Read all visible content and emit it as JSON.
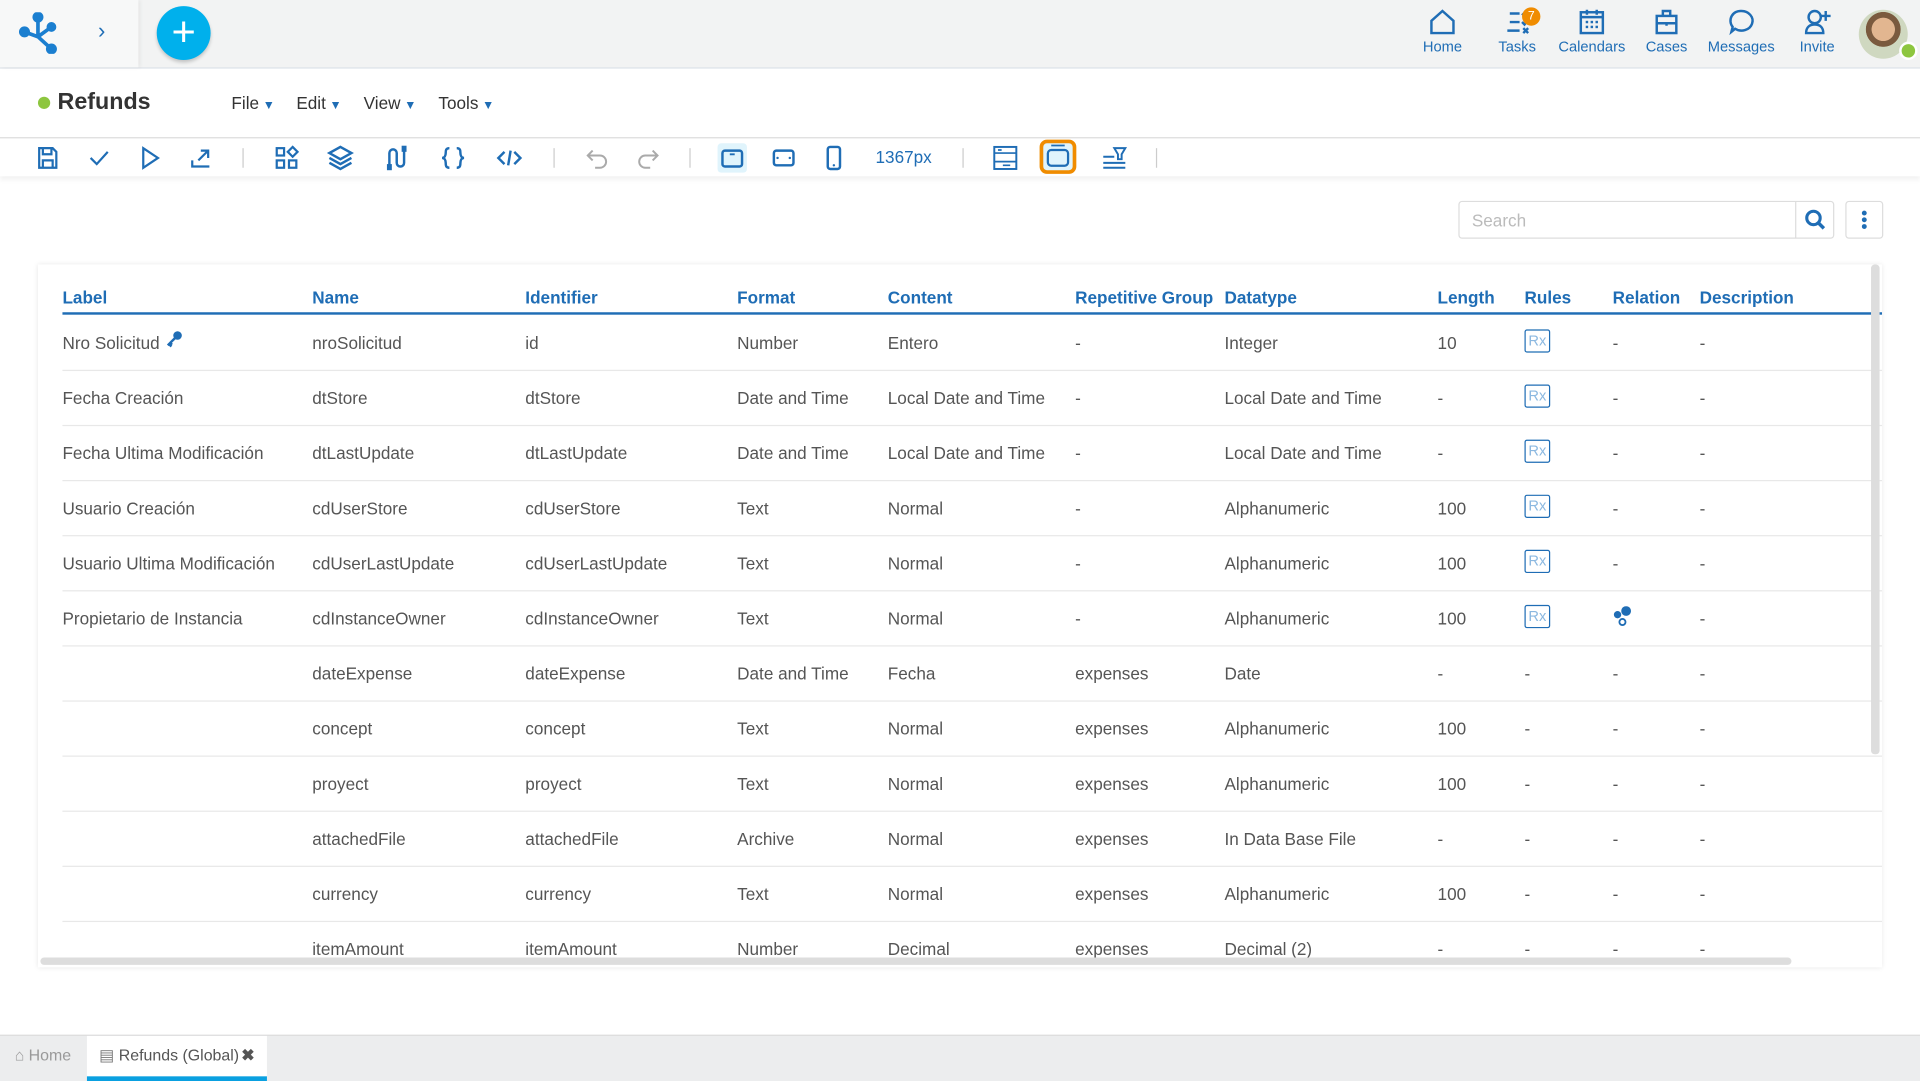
{
  "colors": {
    "accent": "#1f6db5",
    "add": "#00b0ec",
    "status": "#8dc63f",
    "badge": "#f08c00",
    "highlight": "#f08c00"
  },
  "topnav": {
    "items": [
      {
        "label": "Home",
        "icon": "home-icon"
      },
      {
        "label": "Tasks",
        "icon": "tasks-icon",
        "badge": "7"
      },
      {
        "label": "Calendars",
        "icon": "calendar-icon"
      },
      {
        "label": "Cases",
        "icon": "briefcase-icon"
      },
      {
        "label": "Messages",
        "icon": "message-icon"
      },
      {
        "label": "Invite",
        "icon": "invite-user-icon"
      }
    ]
  },
  "header": {
    "title": "Refunds",
    "menus": [
      "File",
      "Edit",
      "View",
      "Tools"
    ]
  },
  "toolbar": {
    "width_label": "1367px"
  },
  "search": {
    "placeholder": "Search",
    "value": ""
  },
  "table": {
    "columns": [
      "Label",
      "Name",
      "Identifier",
      "Format",
      "Content",
      "Repetitive Group",
      "Datatype",
      "Length",
      "Rules",
      "Relation",
      "Description"
    ],
    "rows": [
      {
        "label": "Nro Solicitud",
        "key": true,
        "name": "nroSolicitud",
        "identifier": "id",
        "format": "Number",
        "content": "Entero",
        "group": "-",
        "datatype": "Integer",
        "length": "10",
        "rules": "Rx",
        "relation": "-",
        "description": "-"
      },
      {
        "label": "Fecha Creación",
        "name": "dtStore",
        "identifier": "dtStore",
        "format": "Date and Time",
        "content": "Local Date and Time",
        "group": "-",
        "datatype": "Local Date and Time",
        "length": "-",
        "rules": "Rx",
        "relation": "-",
        "description": "-"
      },
      {
        "label": "Fecha Ultima Modificación",
        "name": "dtLastUpdate",
        "identifier": "dtLastUpdate",
        "format": "Date and Time",
        "content": "Local Date and Time",
        "group": "-",
        "datatype": "Local Date and Time",
        "length": "-",
        "rules": "Rx",
        "relation": "-",
        "description": "-"
      },
      {
        "label": "Usuario Creación",
        "name": "cdUserStore",
        "identifier": "cdUserStore",
        "format": "Text",
        "content": "Normal",
        "group": "-",
        "datatype": "Alphanumeric",
        "length": "100",
        "rules": "Rx",
        "relation": "-",
        "description": "-"
      },
      {
        "label": "Usuario Ultima Modificación",
        "name": "cdUserLastUpdate",
        "identifier": "cdUserLastUpdate",
        "format": "Text",
        "content": "Normal",
        "group": "-",
        "datatype": "Alphanumeric",
        "length": "100",
        "rules": "Rx",
        "relation": "-",
        "description": "-"
      },
      {
        "label": "Propietario de Instancia",
        "name": "cdInstanceOwner",
        "identifier": "cdInstanceOwner",
        "format": "Text",
        "content": "Normal",
        "group": "-",
        "datatype": "Alphanumeric",
        "length": "100",
        "rules": "Rx",
        "relation": "relation-icon",
        "description": "-"
      },
      {
        "label": "",
        "name": "dateExpense",
        "identifier": "dateExpense",
        "format": "Date and Time",
        "content": "Fecha",
        "group": "expenses",
        "datatype": "Date",
        "length": "-",
        "rules": "-",
        "relation": "-",
        "description": "-"
      },
      {
        "label": "",
        "name": "concept",
        "identifier": "concept",
        "format": "Text",
        "content": "Normal",
        "group": "expenses",
        "datatype": "Alphanumeric",
        "length": "100",
        "rules": "-",
        "relation": "-",
        "description": "-"
      },
      {
        "label": "",
        "name": "proyect",
        "identifier": "proyect",
        "format": "Text",
        "content": "Normal",
        "group": "expenses",
        "datatype": "Alphanumeric",
        "length": "100",
        "rules": "-",
        "relation": "-",
        "description": "-"
      },
      {
        "label": "",
        "name": "attachedFile",
        "identifier": "attachedFile",
        "format": "Archive",
        "content": "Normal",
        "group": "expenses",
        "datatype": "In Data Base File",
        "length": "-",
        "rules": "-",
        "relation": "-",
        "description": "-"
      },
      {
        "label": "",
        "name": "currency",
        "identifier": "currency",
        "format": "Text",
        "content": "Normal",
        "group": "expenses",
        "datatype": "Alphanumeric",
        "length": "100",
        "rules": "-",
        "relation": "-",
        "description": "-"
      },
      {
        "label": "",
        "name": "itemAmount",
        "identifier": "itemAmount",
        "format": "Number",
        "content": "Decimal",
        "group": "expenses",
        "datatype": "Decimal (2)",
        "length": "-",
        "rules": "-",
        "relation": "-",
        "description": "-"
      }
    ]
  },
  "bottom_tabs": [
    {
      "label": "Home"
    },
    {
      "label": "Refunds (Global)",
      "active": true
    }
  ]
}
